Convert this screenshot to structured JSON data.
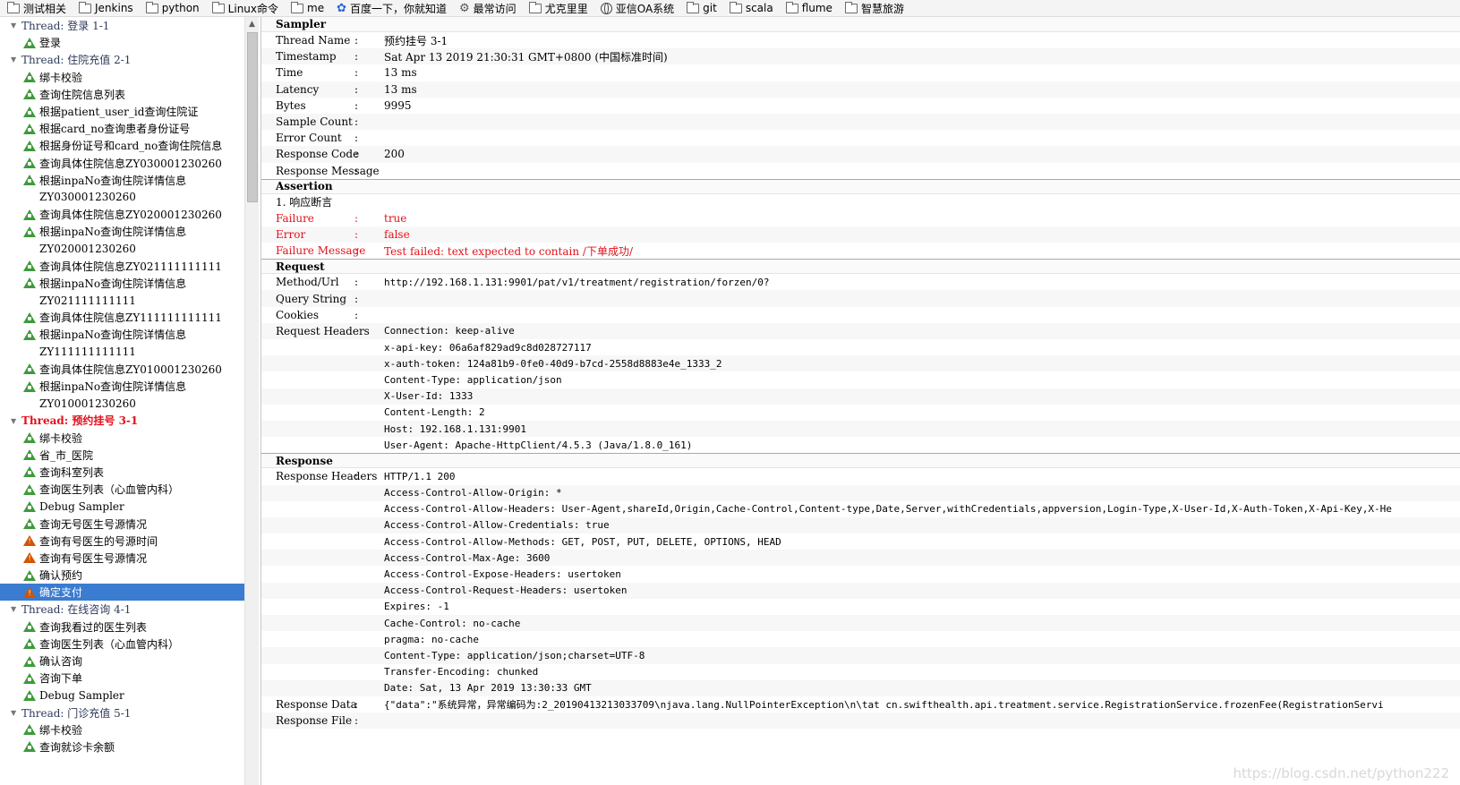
{
  "bookmarks": [
    {
      "label": "测试相关",
      "icon": "folder-icon"
    },
    {
      "label": "Jenkins",
      "icon": "folder-icon"
    },
    {
      "label": "python",
      "icon": "folder-icon"
    },
    {
      "label": "Linux命令",
      "icon": "folder-icon"
    },
    {
      "label": "me",
      "icon": "folder-icon"
    },
    {
      "label": "百度一下，你就知道",
      "icon": "paw-icon"
    },
    {
      "label": "最常访问",
      "icon": "gear-icon"
    },
    {
      "label": "尤克里里",
      "icon": "folder-icon"
    },
    {
      "label": "亚信OA系统",
      "icon": "globe-icon"
    },
    {
      "label": "git",
      "icon": "folder-icon"
    },
    {
      "label": "scala",
      "icon": "folder-icon"
    },
    {
      "label": "flume",
      "icon": "folder-icon"
    },
    {
      "label": "智慧旅游",
      "icon": "folder-icon"
    }
  ],
  "tree": [
    {
      "type": "thread",
      "label": "Thread: 登录 1-1"
    },
    {
      "type": "sampler",
      "label": "登录",
      "status": "success"
    },
    {
      "type": "thread",
      "label": "Thread: 住院充值 2-1"
    },
    {
      "type": "sampler",
      "label": "绑卡校验",
      "status": "success"
    },
    {
      "type": "sampler",
      "label": "查询住院信息列表",
      "status": "success"
    },
    {
      "type": "sampler",
      "label": "根据patient_user_id查询住院证",
      "status": "success"
    },
    {
      "type": "sampler",
      "label": "根据card_no查询患者身份证号",
      "status": "success"
    },
    {
      "type": "sampler",
      "label": "根据身份证号和card_no查询住院信息",
      "status": "success"
    },
    {
      "type": "sampler",
      "label": "查询具体住院信息ZY030001230260",
      "status": "success"
    },
    {
      "type": "sampler",
      "label": "根据inpaNo查询住院详情信息",
      "status": "success"
    },
    {
      "type": "cont",
      "label": "ZY030001230260"
    },
    {
      "type": "sampler",
      "label": "查询具体住院信息ZY020001230260",
      "status": "success"
    },
    {
      "type": "sampler",
      "label": "根据inpaNo查询住院详情信息",
      "status": "success"
    },
    {
      "type": "cont",
      "label": "ZY020001230260"
    },
    {
      "type": "sampler",
      "label": "查询具体住院信息ZY021111111111",
      "status": "success"
    },
    {
      "type": "sampler",
      "label": "根据inpaNo查询住院详情信息",
      "status": "success"
    },
    {
      "type": "cont",
      "label": "ZY021111111111"
    },
    {
      "type": "sampler",
      "label": "查询具体住院信息ZY111111111111",
      "status": "success"
    },
    {
      "type": "sampler",
      "label": "根据inpaNo查询住院详情信息",
      "status": "success"
    },
    {
      "type": "cont",
      "label": "ZY111111111111"
    },
    {
      "type": "sampler",
      "label": "查询具体住院信息ZY010001230260",
      "status": "success"
    },
    {
      "type": "sampler",
      "label": "根据inpaNo查询住院详情信息",
      "status": "success"
    },
    {
      "type": "cont",
      "label": "ZY010001230260"
    },
    {
      "type": "thread",
      "label": "Thread: 预约挂号 3-1",
      "active": true
    },
    {
      "type": "sampler",
      "label": "绑卡校验",
      "status": "success"
    },
    {
      "type": "sampler",
      "label": "省_市_医院",
      "status": "success"
    },
    {
      "type": "sampler",
      "label": "查询科室列表",
      "status": "success"
    },
    {
      "type": "sampler",
      "label": "查询医生列表（心血管内科）",
      "status": "success"
    },
    {
      "type": "sampler",
      "label": "Debug Sampler",
      "status": "success"
    },
    {
      "type": "sampler",
      "label": "查询无号医生号源情况",
      "status": "success"
    },
    {
      "type": "sampler",
      "label": "查询有号医生的号源时间",
      "status": "failure"
    },
    {
      "type": "sampler",
      "label": "查询有号医生号源情况",
      "status": "failure"
    },
    {
      "type": "sampler",
      "label": "确认预约",
      "status": "success"
    },
    {
      "type": "sampler",
      "label": "确定支付",
      "status": "failure",
      "selected": true
    },
    {
      "type": "thread",
      "label": "Thread: 在线咨询 4-1"
    },
    {
      "type": "sampler",
      "label": "查询我看过的医生列表",
      "status": "success"
    },
    {
      "type": "sampler",
      "label": "查询医生列表（心血管内科）",
      "status": "success"
    },
    {
      "type": "sampler",
      "label": "确认咨询",
      "status": "success"
    },
    {
      "type": "sampler",
      "label": "咨询下单",
      "status": "success"
    },
    {
      "type": "sampler",
      "label": "Debug Sampler",
      "status": "success"
    },
    {
      "type": "thread",
      "label": "Thread: 门诊充值 5-1"
    },
    {
      "type": "sampler",
      "label": "绑卡校验",
      "status": "success"
    },
    {
      "type": "sampler",
      "label": "查询就诊卡余额",
      "status": "success"
    }
  ],
  "detail": {
    "colon": ":",
    "sampler": {
      "title": "Sampler",
      "rows": [
        {
          "k": "Thread Name",
          "v": "预约挂号 3-1"
        },
        {
          "k": "Timestamp",
          "v": "Sat Apr 13 2019 21:30:31 GMT+0800 (中国标准时间)"
        },
        {
          "k": "Time",
          "v": "13 ms"
        },
        {
          "k": "Latency",
          "v": "13 ms"
        },
        {
          "k": "Bytes",
          "v": "9995"
        },
        {
          "k": "Sample Count",
          "v": ""
        },
        {
          "k": "Error Count",
          "v": ""
        },
        {
          "k": "Response Code",
          "v": "200"
        },
        {
          "k": "Response Message",
          "v": ""
        }
      ]
    },
    "assertion": {
      "title": "Assertion",
      "item": "1. 响应断言",
      "rows": [
        {
          "k": "Failure",
          "v": "true"
        },
        {
          "k": "Error",
          "v": "false"
        },
        {
          "k": "Failure Message",
          "v": "Test failed: text expected to contain /下单成功/"
        }
      ]
    },
    "request": {
      "title": "Request",
      "method_url_label": "Method/Url",
      "method_url": " http://192.168.1.131:9901/pat/v1/treatment/registration/forzen/0?",
      "query_string_label": "Query String",
      "cookies_label": "Cookies",
      "headers_label": "Request Headers",
      "headers": [
        "Connection: keep-alive",
        "x-api-key: 06a6af829ad9c8d028727117",
        "x-auth-token: 124a81b9-0fe0-40d9-b7cd-2558d8883e4e_1333_2",
        "Content-Type: application/json",
        "X-User-Id: 1333",
        "Content-Length: 2",
        "Host: 192.168.1.131:9901",
        "User-Agent: Apache-HttpClient/4.5.3 (Java/1.8.0_161)"
      ]
    },
    "response": {
      "title": "Response",
      "headers_label": "Response Headers",
      "headers": [
        "HTTP/1.1 200",
        "Access-Control-Allow-Origin: *",
        "Access-Control-Allow-Headers: User-Agent,shareId,Origin,Cache-Control,Content-type,Date,Server,withCredentials,appversion,Login-Type,X-User-Id,X-Auth-Token,X-Api-Key,X-He",
        "Access-Control-Allow-Credentials: true",
        "Access-Control-Allow-Methods: GET, POST, PUT, DELETE, OPTIONS, HEAD",
        "Access-Control-Max-Age: 3600",
        "Access-Control-Expose-Headers: usertoken",
        "Access-Control-Request-Headers: usertoken",
        "Expires: -1",
        "Cache-Control: no-cache",
        "pragma: no-cache",
        "Content-Type: application/json;charset=UTF-8",
        "Transfer-Encoding: chunked",
        "Date: Sat, 13 Apr 2019 13:30:33 GMT"
      ],
      "data_label": "Response Data",
      "data": "{\"data\":\"系统异常，异常编码为:2_20190413213033709\\njava.lang.NullPointerException\\n\\tat cn.swifthealth.api.treatment.service.RegistrationService.frozenFee(RegistrationServi",
      "file_label": "Response File"
    }
  },
  "watermark": "https://blog.csdn.net/python222"
}
